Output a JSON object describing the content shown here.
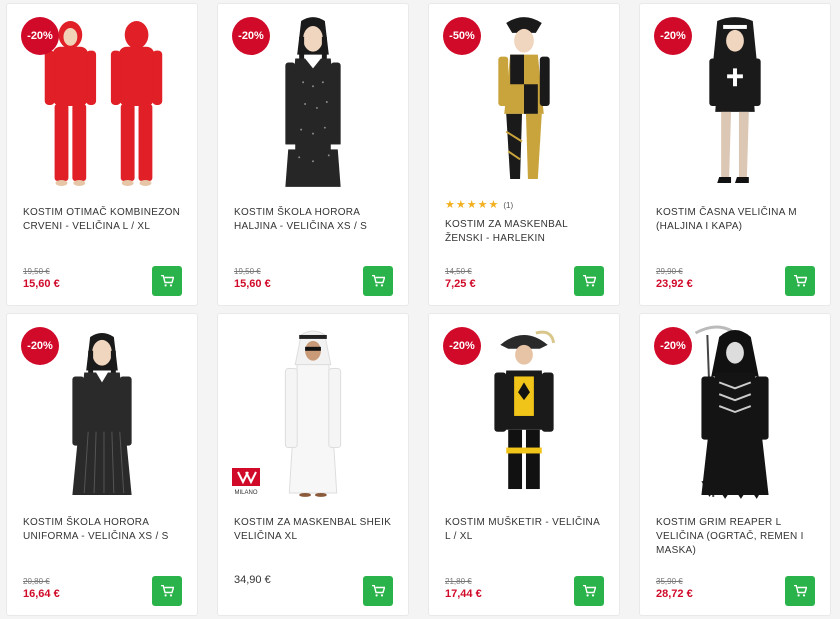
{
  "colors": {
    "discount_badge": "#d10a2a",
    "sale_price": "#d10a2a",
    "cart_button": "#2ab34a",
    "star": "#f2b01e"
  },
  "products": [
    {
      "badge": "-20%",
      "title": "KOSTIM OTIMAČ KOMBINEZON CRVENI - VELIČINA L / XL",
      "old_price": "19,50 €",
      "price": "15,60 €",
      "image_icon": "red-jumpsuit-costume"
    },
    {
      "badge": "-20%",
      "title": "KOSTIM ŠKOLA HORORA HALJINA - VELIČINA XS / S",
      "old_price": "19,50 €",
      "price": "15,60 €",
      "image_icon": "black-dress-costume"
    },
    {
      "badge": "-50%",
      "title": "KOSTIM ZA MASKENBAL ŽENSKI - HARLEKIN",
      "old_price": "14,50 €",
      "price": "7,25 €",
      "rating": 5,
      "rating_count": "(1)",
      "image_icon": "harlequin-costume"
    },
    {
      "badge": "-20%",
      "title": "KOSTIM ČASNA VELIČINA M (HALJINA I KAPA)",
      "old_price": "29,90 €",
      "price": "23,92 €",
      "image_icon": "nun-costume"
    },
    {
      "badge": "-20%",
      "title": "KOSTIM ŠKOLA HORORA UNIFORMA - VELIČINA XS / S",
      "old_price": "20,80 €",
      "price": "16,64 €",
      "image_icon": "striped-dress-costume"
    },
    {
      "badge": "",
      "title": "KOSTIM ZA MASKENBAL SHEIK VELIČINA XL",
      "old_price": "",
      "price": "34,90 €",
      "image_icon": "sheik-costume",
      "brand_logo": "MILANO"
    },
    {
      "badge": "-20%",
      "title": "KOSTIM MUŠKETIR - VELIČINA L / XL",
      "old_price": "21,80 €",
      "price": "17,44 €",
      "image_icon": "musketeer-costume"
    },
    {
      "badge": "-20%",
      "title": "KOSTIM GRIM REAPER L VELIČINA (OGRTAČ, REMEN I MASKA)",
      "old_price": "35,90 €",
      "price": "28,72 €",
      "image_icon": "grim-reaper-costume"
    }
  ]
}
